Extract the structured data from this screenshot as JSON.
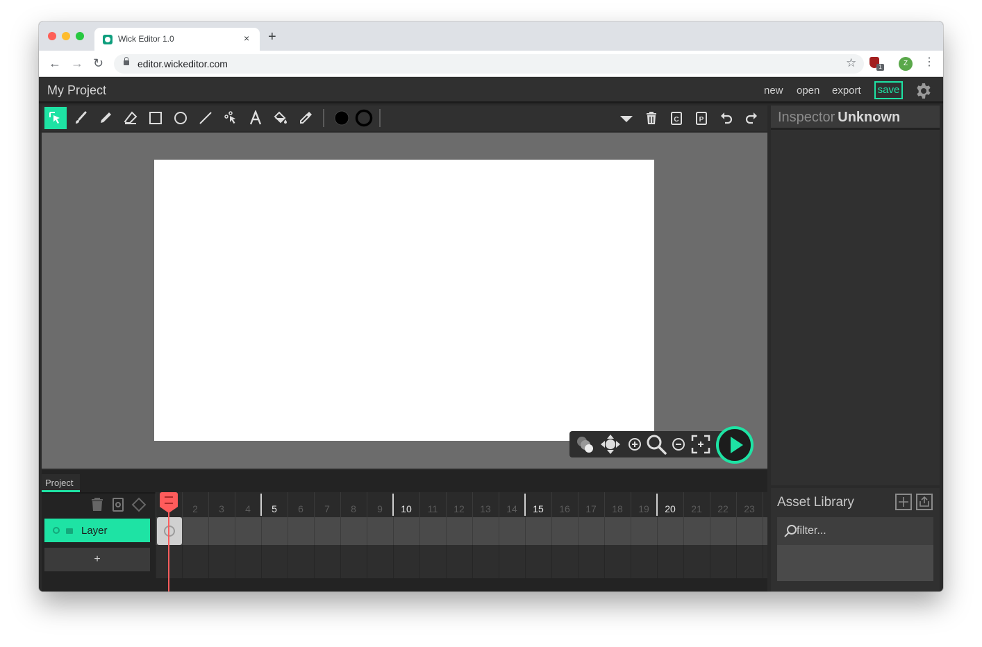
{
  "browser": {
    "tab_title": "Wick Editor 1.0",
    "tab_close": "×",
    "new_tab": "+",
    "url": "editor.wickeditor.com",
    "back": "←",
    "forward": "→",
    "reload": "↻",
    "star": "☆",
    "extension_badge": "1",
    "avatar_letter": "Z",
    "menu": "⋮"
  },
  "editor": {
    "project_name": "My Project",
    "menu": {
      "new": "new",
      "open": "open",
      "export": "export",
      "save": "save"
    }
  },
  "toolbar": {
    "tools": [
      "cursor-icon",
      "brush-icon",
      "pencil-icon",
      "eraser-icon",
      "rectangle-icon",
      "ellipse-icon",
      "line-icon",
      "path-cursor-icon",
      "text-icon",
      "fill-bucket-icon",
      "eyedropper-icon"
    ],
    "active_tool": "cursor-icon",
    "fill_color": "#000000",
    "stroke_color": "#000000"
  },
  "colors": {
    "accent": "#1ee3a4",
    "playhead": "#ff5c5c"
  },
  "inspector": {
    "title": "Inspector",
    "subtitle": "Unknown"
  },
  "asset_library": {
    "title": "Asset Library",
    "filter_placeholder": "filter..."
  },
  "timeline": {
    "tab": "Project",
    "frame_numbers": [
      "2",
      "3",
      "4",
      "5",
      "6",
      "7",
      "8",
      "9",
      "10",
      "11",
      "12",
      "13",
      "14",
      "15",
      "16",
      "17",
      "18",
      "19",
      "20",
      "21",
      "22",
      "23"
    ],
    "major_frames": [
      "5",
      "10",
      "15",
      "20"
    ],
    "current_frame": 1,
    "layer_name": "Layer",
    "add_layer": "+"
  }
}
